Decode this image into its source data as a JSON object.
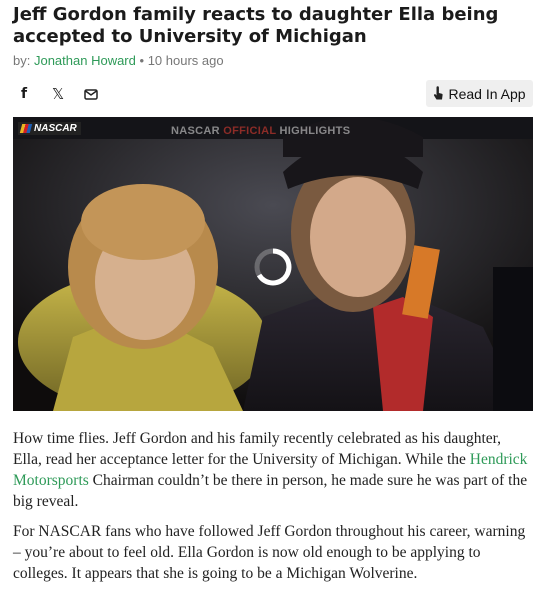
{
  "article": {
    "headline": "Jeff Gordon family reacts to daughter Ella being accepted to University of Michigan",
    "byline_prefix": "by:",
    "author": "Jonathan Howard",
    "separator": "•",
    "time_ago": "10 hours ago",
    "paragraphs": [
      {
        "before": "How time flies. Jeff Gordon and his family recently celebrated as his daughter, Ella, read her acceptance letter for the University of Michigan. While the ",
        "link": "Hendrick Motorsports",
        "after": " Chairman couldn’t be there in person, he made sure he was part of the big reveal."
      },
      {
        "text": "For NASCAR fans who have followed Jeff Gordon throughout his career, warning – you’re about to feel old. Ella Gordon is now old enough to be applying to colleges. It appears that she is going to be a Michigan Wolverine."
      }
    ]
  },
  "share": {
    "facebook_label": "f",
    "x_label": "𝕏",
    "icons": [
      "facebook-icon",
      "x-icon",
      "mail-icon"
    ]
  },
  "read_in_app": {
    "label": "Read In App",
    "icon": "phone-tap-icon"
  },
  "video": {
    "logo_text": "NASCAR",
    "title_prefix": "NASCAR ",
    "title_official": "OFFICIAL",
    "title_suffix": " HIGHLIGHTS",
    "state": "loading"
  },
  "colors": {
    "link": "#2e9a58",
    "headline": "#1b1b1b",
    "meta": "#777777"
  }
}
